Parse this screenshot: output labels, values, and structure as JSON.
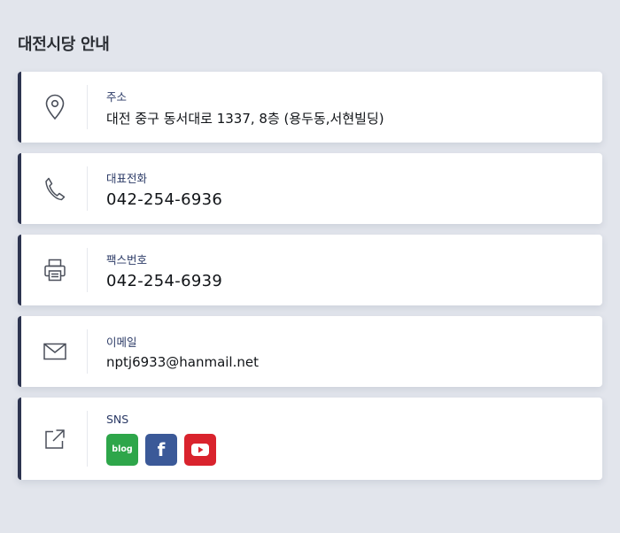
{
  "title": "대전시당 안내",
  "cards": {
    "address": {
      "label": "주소",
      "value": "대전 중구 동서대로 1337, 8층 (용두동,서현빌딩)",
      "icon": "map-pin-icon"
    },
    "phone": {
      "label": "대표전화",
      "value": "042-254-6936",
      "icon": "phone-icon"
    },
    "fax": {
      "label": "팩스번호",
      "value": "042-254-6939",
      "icon": "printer-icon"
    },
    "email": {
      "label": "이메일",
      "value": "nptj6933@hanmail.net",
      "icon": "mail-icon"
    },
    "sns": {
      "label": "SNS",
      "icon": "external-link-icon",
      "links": [
        {
          "name": "blog",
          "text": "blog",
          "color": "#2ea64a"
        },
        {
          "name": "facebook",
          "text": "f",
          "color": "#3b5998"
        },
        {
          "name": "youtube",
          "text": "",
          "color": "#d9232d"
        }
      ]
    }
  },
  "colors": {
    "background": "#e2e5ec",
    "accent_border": "#2d3450",
    "label": "#2b3a66"
  }
}
